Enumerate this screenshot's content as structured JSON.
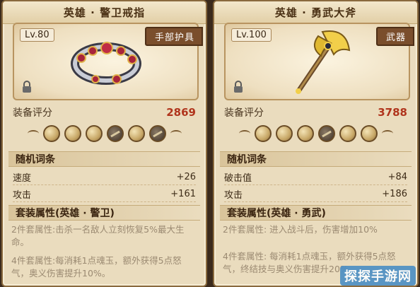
{
  "cards": [
    {
      "title": "英雄 · 警卫戒指",
      "level": "Lv.80",
      "slot_tag": "手部护具",
      "score_label": "装备评分",
      "score_value": "2869",
      "random_header": "随机词条",
      "stats": [
        {
          "name": "速度",
          "value": "+26"
        },
        {
          "name": "攻击",
          "value": "+161"
        }
      ],
      "set_header": "套装属性(英雄 · 警卫)",
      "set_effects": [
        "2件套属性:击杀一名敌人立刻恢复5%最大生命。",
        "4件套属性:每消耗1点魂玉，额外获得5点怒气，奥义伤害提升10%。"
      ]
    },
    {
      "title": "英雄 · 勇武大斧",
      "level": "Lv.100",
      "slot_tag": "武器",
      "score_label": "装备评分",
      "score_value": "3788",
      "random_header": "随机词条",
      "stats": [
        {
          "name": "破击值",
          "value": "+84"
        },
        {
          "name": "攻击",
          "value": "+186"
        }
      ],
      "set_header": "套装属性(英雄 · 勇武)",
      "set_effects": [
        "2件套属性:  进入战斗后，伤害增加10%",
        "4件套属性:  每消耗1点魂玉，额外获得5点怒气，终结技与奥义伤害提升20%"
      ]
    }
  ],
  "watermark": "探探手游网",
  "icons": {
    "lock": "lock-icon",
    "gem_filled": "gem-icon",
    "gem_slot": "gem-slot-icon"
  },
  "colors": {
    "score": "#b0341c",
    "panel": "#eadcbe",
    "tag": "#7a4e2c"
  }
}
